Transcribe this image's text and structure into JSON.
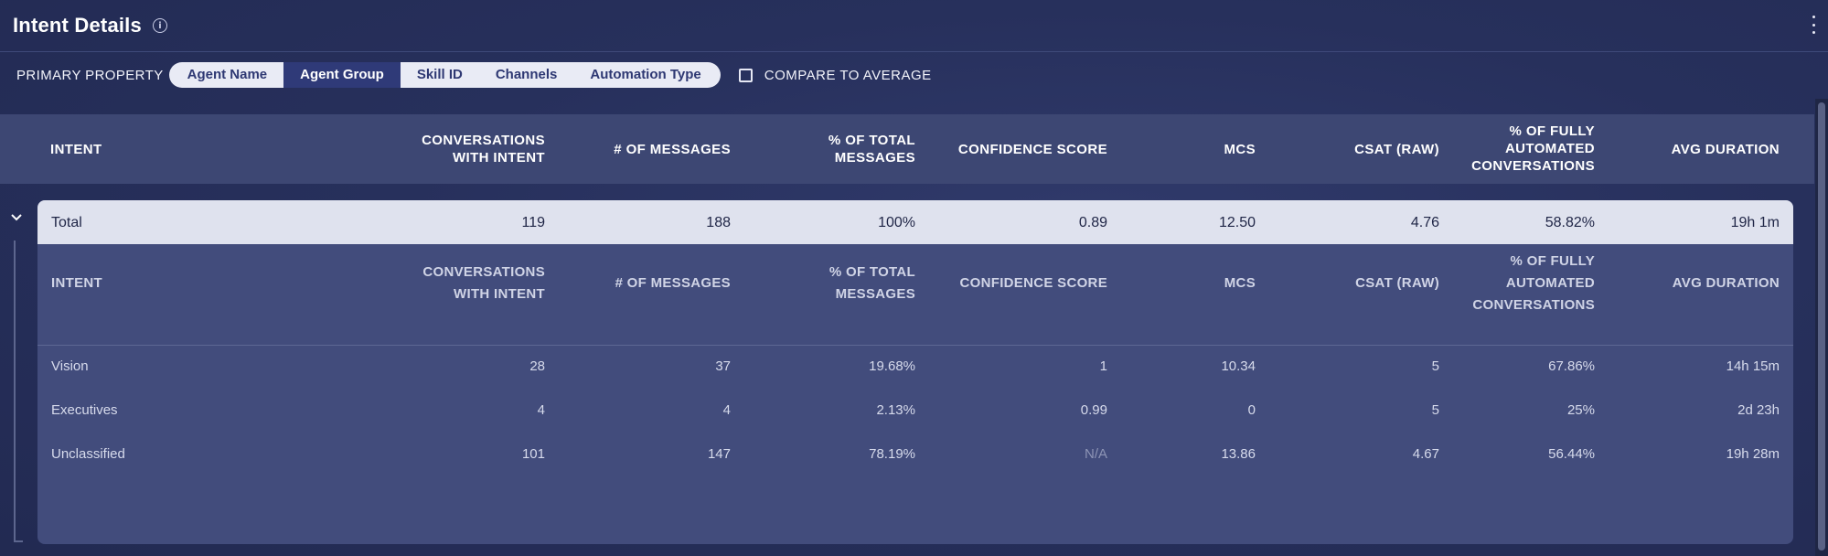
{
  "header": {
    "title": "Intent Details"
  },
  "filters": {
    "primary_label": "PRIMARY PROPERTY",
    "options": [
      "Agent Name",
      "Agent Group",
      "Skill ID",
      "Channels",
      "Automation Type"
    ],
    "selected": "Agent Group",
    "compare_label": "COMPARE TO AVERAGE",
    "compare_checked": false
  },
  "columns": {
    "intent": "INTENT",
    "conversations": [
      "CONVERSATIONS",
      "WITH INTENT"
    ],
    "messages": "# OF MESSAGES",
    "pct_messages": [
      "% OF TOTAL",
      "MESSAGES"
    ],
    "confidence": "CONFIDENCE SCORE",
    "mcs": "MCS",
    "csat": "CSAT (RAW)",
    "pct_automated": [
      "% OF FULLY",
      "AUTOMATED",
      "CONVERSATIONS"
    ],
    "avg_duration": "AVG DURATION"
  },
  "total": {
    "label": "Total",
    "conversations": "119",
    "messages": "188",
    "pct_messages": "100%",
    "confidence": "0.89",
    "mcs": "12.50",
    "csat": "4.76",
    "pct_automated": "58.82%",
    "avg_duration": "19h 1m"
  },
  "rows": [
    {
      "intent": "Vision",
      "conversations": "28",
      "messages": "37",
      "pct_messages": "19.68%",
      "confidence": "1",
      "mcs": "10.34",
      "csat": "5",
      "pct_automated": "67.86%",
      "avg_duration": "14h 15m"
    },
    {
      "intent": "Executives",
      "conversations": "4",
      "messages": "4",
      "pct_messages": "2.13%",
      "confidence": "0.99",
      "mcs": "0",
      "csat": "5",
      "pct_automated": "25%",
      "avg_duration": "2d 23h"
    },
    {
      "intent": "Unclassified",
      "conversations": "101",
      "messages": "147",
      "pct_messages": "78.19%",
      "confidence": "N/A",
      "mcs": "13.86",
      "csat": "4.67",
      "pct_automated": "56.44%",
      "avg_duration": "19h 28m"
    }
  ]
}
